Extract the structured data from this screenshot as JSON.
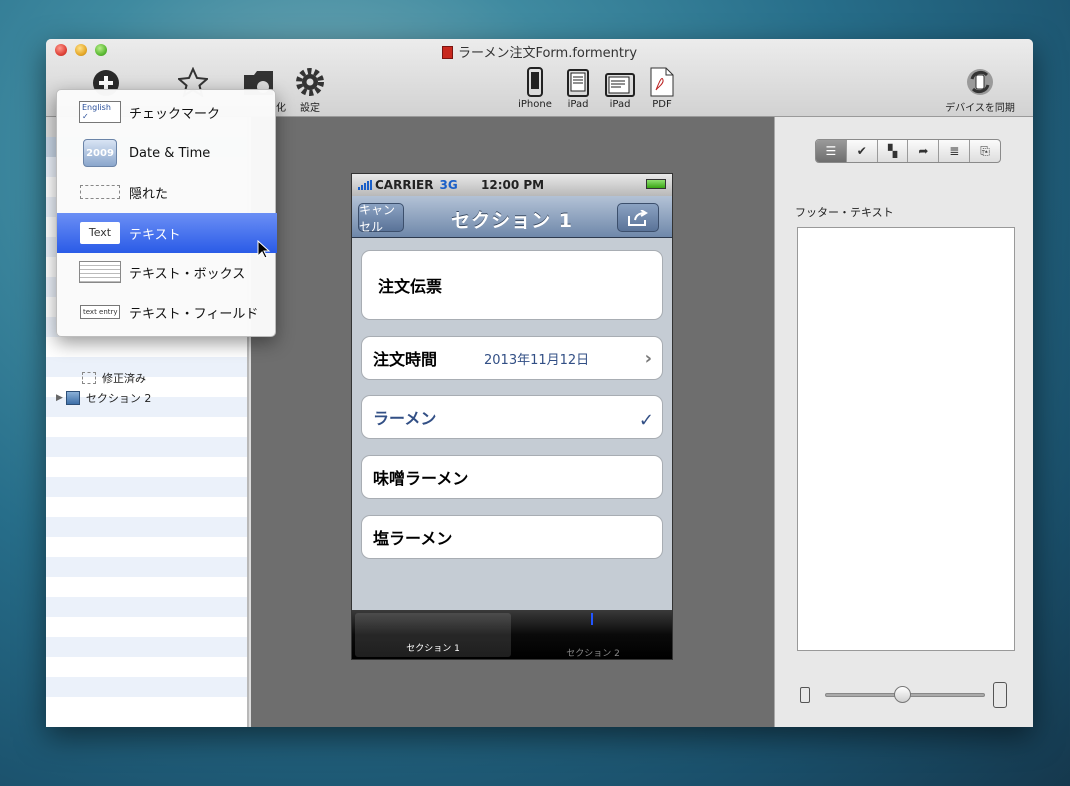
{
  "window": {
    "title": "ラーメン注文Form.formentry"
  },
  "toolbar": {
    "settings_label": "設定",
    "partial_label": "化",
    "iphone_label": "iPhone",
    "ipad1_label": "iPad",
    "ipad2_label": "iPad",
    "pdf_label": "PDF",
    "sync_label": "デバイスを同期"
  },
  "popup_menu": {
    "items": [
      {
        "label": "チェックマーク",
        "thumb": "English ✓"
      },
      {
        "label": "Date & Time",
        "thumb": "2009"
      },
      {
        "label": "隠れた",
        "thumb": ""
      },
      {
        "label": "テキスト",
        "thumb": "Text",
        "selected": true
      },
      {
        "label": "テキスト・ボックス",
        "thumb": ""
      },
      {
        "label": "テキスト・フィールド",
        "thumb": "text entry"
      }
    ]
  },
  "sidebar": {
    "modified_label": "修正済み",
    "section2_label": "セクション 2"
  },
  "phone": {
    "carrier": "CARRIER",
    "network": "3G",
    "time": "12:00 PM",
    "cancel_label": "キャンセル",
    "nav_title": "セクション 1",
    "cells": [
      {
        "label": "注文伝票"
      },
      {
        "label": "注文時間",
        "value": "2013年11月12日"
      },
      {
        "label": "ラーメン",
        "checked": true
      },
      {
        "label": "味噌ラーメン"
      },
      {
        "label": "塩ラーメン"
      }
    ],
    "tabs": [
      "セクション 1",
      "セクション 2"
    ]
  },
  "inspector": {
    "footer_label": "フッター・テキスト",
    "footer_value": "",
    "zoom_slider": 0.48
  }
}
